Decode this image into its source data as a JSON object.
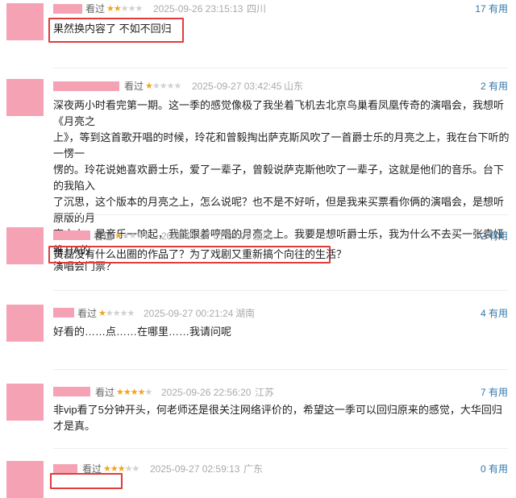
{
  "reviews": [
    {
      "watched": "看过",
      "stars": 2,
      "time": "2025-09-26 23:15:13",
      "location": "四川",
      "useful": "17 有用",
      "content": "果然换内容了 不如不回归",
      "highlighted": true
    },
    {
      "watched": "看过",
      "stars": 1,
      "time": "2025-09-27 03:42:45",
      "location": "山东",
      "useful": "2 有用",
      "content_lines": [
        "深夜两小时看完第一期。这一季的感觉像极了我坐着飞机去北京鸟巢看凤凰传奇的演唱会，我想听《月亮之",
        "上》，等到这首歌开唱的时候，玲花和曾毅掏出萨克斯风吹了一首爵士乐的月亮之上，我在台下听的一愣一",
        "愣的。玲花说她喜欢爵士乐，爱了一辈子，曾毅说萨克斯他吹了一辈子，这就是他们的音乐。台下的我陷入",
        "了沉思，这个版本的月亮之上，怎么说呢？也不是不好听，但是我来买票看你俩的演唱会，是想听原版的月",
        "亮之上。是音乐一响起，我能跟着哼唱的月亮之上。我要是想听爵士乐，我为什么不去买一张袁娅维TIA的",
        "演唱会门票？"
      ]
    },
    {
      "watched": "看过",
      "stars": 1,
      "time": "2025-09-27 01:39:09",
      "location": "重庆",
      "useful": "2 有用",
      "content": "黄磊没有什么出圈的作品了？为了戏剧又重新搞个向往的生活？",
      "highlighted": true
    },
    {
      "watched": "看过",
      "stars": 1,
      "time": "2025-09-27 00:21:24",
      "location": "湖南",
      "useful": "4 有用",
      "content": "好看的……点……在哪里……我请问呢"
    },
    {
      "watched": "看过",
      "stars": 4,
      "time": "2025-09-26 22:56:20",
      "location": "江苏",
      "useful": "7 有用",
      "content": "非vip看了5分钟开头，何老师还是很关注网络评价的，希望这一季可以回归原来的感觉，大华回归才是真。"
    },
    {
      "watched": "看过",
      "stars": 3,
      "time": "2025-09-27 02:59:13",
      "location": "广东",
      "useful": "0 有用"
    }
  ],
  "accent_color": "#e23b3b",
  "star_color": "#f2a51a",
  "mask_color": "#f5a3b4"
}
